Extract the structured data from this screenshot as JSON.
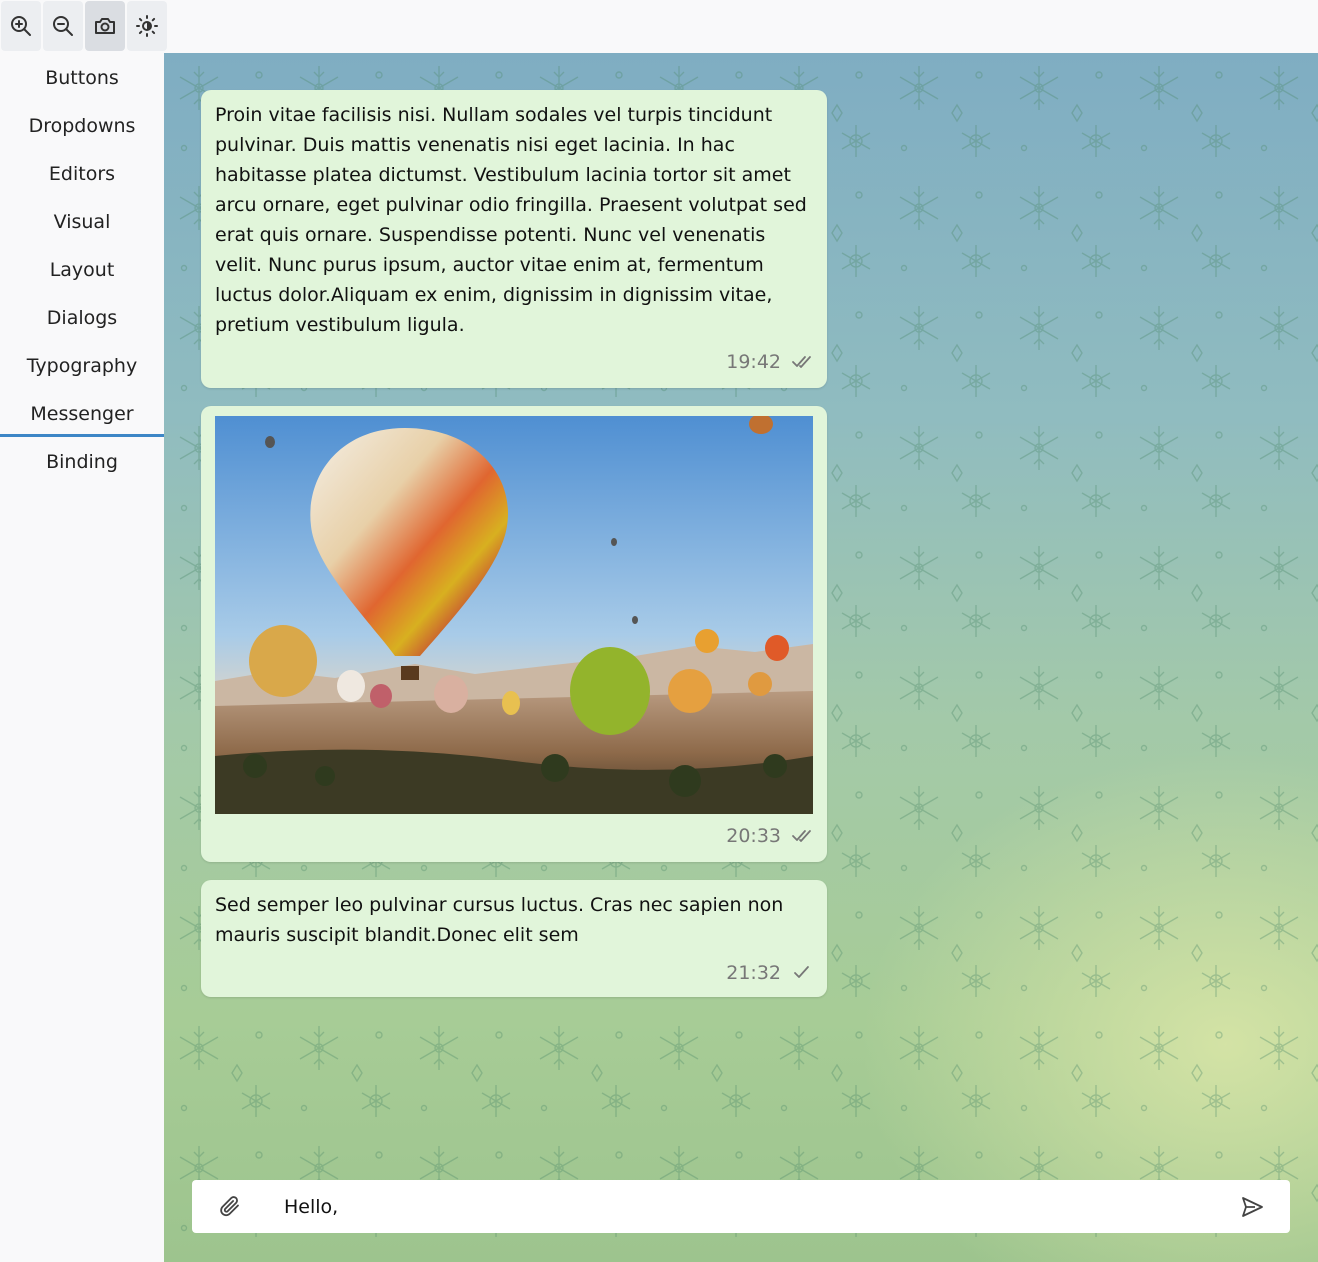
{
  "toolbar": {
    "items": [
      {
        "icon": "zoom-in-icon"
      },
      {
        "icon": "zoom-out-icon"
      },
      {
        "icon": "camera-icon"
      },
      {
        "icon": "brightness-icon"
      }
    ]
  },
  "sidebar": {
    "items": [
      {
        "label": "Buttons"
      },
      {
        "label": "Dropdowns"
      },
      {
        "label": "Editors"
      },
      {
        "label": "Visual"
      },
      {
        "label": "Layout"
      },
      {
        "label": "Dialogs"
      },
      {
        "label": "Typography"
      },
      {
        "label": "Messenger",
        "active": true
      },
      {
        "label": "Binding"
      }
    ]
  },
  "messages": [
    {
      "text": "Proin vitae facilisis nisi. Nullam sodales vel turpis tincidunt pulvinar. Duis mattis venenatis nisi eget lacinia. In hac habitasse platea dictumst. Vestibulum lacinia tortor sit amet arcu ornare, eget pulvinar odio fringilla. Praesent volutpat sed erat quis ornare. Suspendisse potenti. Nunc vel venenatis velit. Nunc purus ipsum, auctor vitae enim at, fermentum  luctus dolor.Aliquam ex enim, dignissim in dignissim vitae,  pretium vestibulum ligula.",
      "time": "19:42",
      "status": "read"
    },
    {
      "image": "hot-air-balloons-photo",
      "time": "20:33",
      "status": "read"
    },
    {
      "text": "Sed semper leo pulvinar cursus luctus. Cras nec  sapien non mauris suscipit blandit.Donec elit sem",
      "time": "21:32",
      "status": "sent"
    }
  ],
  "composer": {
    "value": "Hello,",
    "attach_icon": "paperclip-icon",
    "send_icon": "send-icon"
  },
  "colors": {
    "bubble": "#e1f5da",
    "accent": "#3d86c6"
  }
}
